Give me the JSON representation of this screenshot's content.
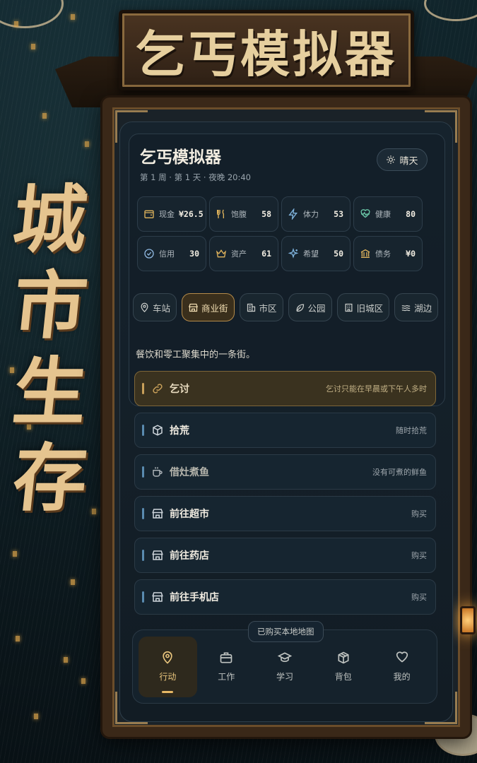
{
  "poster": {
    "sign_title": "乞丐模拟器",
    "side_title": [
      "城",
      "市",
      "生",
      "存"
    ]
  },
  "header": {
    "title": "乞丐模拟器",
    "subtitle": "第 1 周 · 第 1 天 · 夜晚 20:40",
    "weather": {
      "icon": "sun-icon",
      "label": "晴天"
    }
  },
  "stats": [
    {
      "icon": "wallet-icon",
      "label": "现金",
      "value": "¥26.5"
    },
    {
      "icon": "utensils-icon",
      "label": "饱腹",
      "value": "58"
    },
    {
      "icon": "lightning-icon",
      "label": "体力",
      "value": "53"
    },
    {
      "icon": "heart-pulse-icon",
      "label": "健康",
      "value": "80"
    },
    {
      "icon": "check-circle-icon",
      "label": "信用",
      "value": "30"
    },
    {
      "icon": "crown-icon",
      "label": "资产",
      "value": "61"
    },
    {
      "icon": "sparkle-icon",
      "label": "希望",
      "value": "50"
    },
    {
      "icon": "bank-icon",
      "label": "债务",
      "value": "¥0"
    }
  ],
  "locations": [
    {
      "icon": "pin-icon",
      "label": "车站",
      "active": false
    },
    {
      "icon": "storefront-icon",
      "label": "商业街",
      "active": true
    },
    {
      "icon": "building-icon",
      "label": "市区",
      "active": false
    },
    {
      "icon": "leaf-icon",
      "label": "公园",
      "active": false
    },
    {
      "icon": "old-building-icon",
      "label": "旧城区",
      "active": false
    },
    {
      "icon": "waves-icon",
      "label": "湖边",
      "active": false
    }
  ],
  "location_description": "餐饮和零工聚集中的一条街。",
  "actions": [
    {
      "icon": "link-icon",
      "name": "乞讨",
      "hint": "乞讨只能在早晨或下午人多时",
      "style": "highlight"
    },
    {
      "icon": "box-icon",
      "name": "拾荒",
      "hint": "随时拾荒",
      "style": "normal"
    },
    {
      "icon": "cup-icon",
      "name": "借灶煮鱼",
      "hint": "没有可煮的鲜鱼",
      "style": "disabled"
    },
    {
      "icon": "store-icon",
      "name": "前往超市",
      "hint": "购买",
      "style": "normal"
    },
    {
      "icon": "store-icon",
      "name": "前往药店",
      "hint": "购买",
      "style": "normal"
    },
    {
      "icon": "store-icon",
      "name": "前往手机店",
      "hint": "购买",
      "style": "normal"
    }
  ],
  "map_chip": "已购买本地地图",
  "nav": [
    {
      "icon": "pin-icon",
      "label": "行动",
      "active": true
    },
    {
      "icon": "briefcase-icon",
      "label": "工作",
      "active": false
    },
    {
      "icon": "graduation-cap-icon",
      "label": "学习",
      "active": false
    },
    {
      "icon": "package-icon",
      "label": "背包",
      "active": false
    },
    {
      "icon": "heart-icon",
      "label": "我的",
      "active": false
    }
  ],
  "colors": {
    "accent_gold": "#c9a05a",
    "panel_bg": "#16232d",
    "action_bar_blue": "#5a8bb0",
    "active_nav": "#e9c57d"
  }
}
